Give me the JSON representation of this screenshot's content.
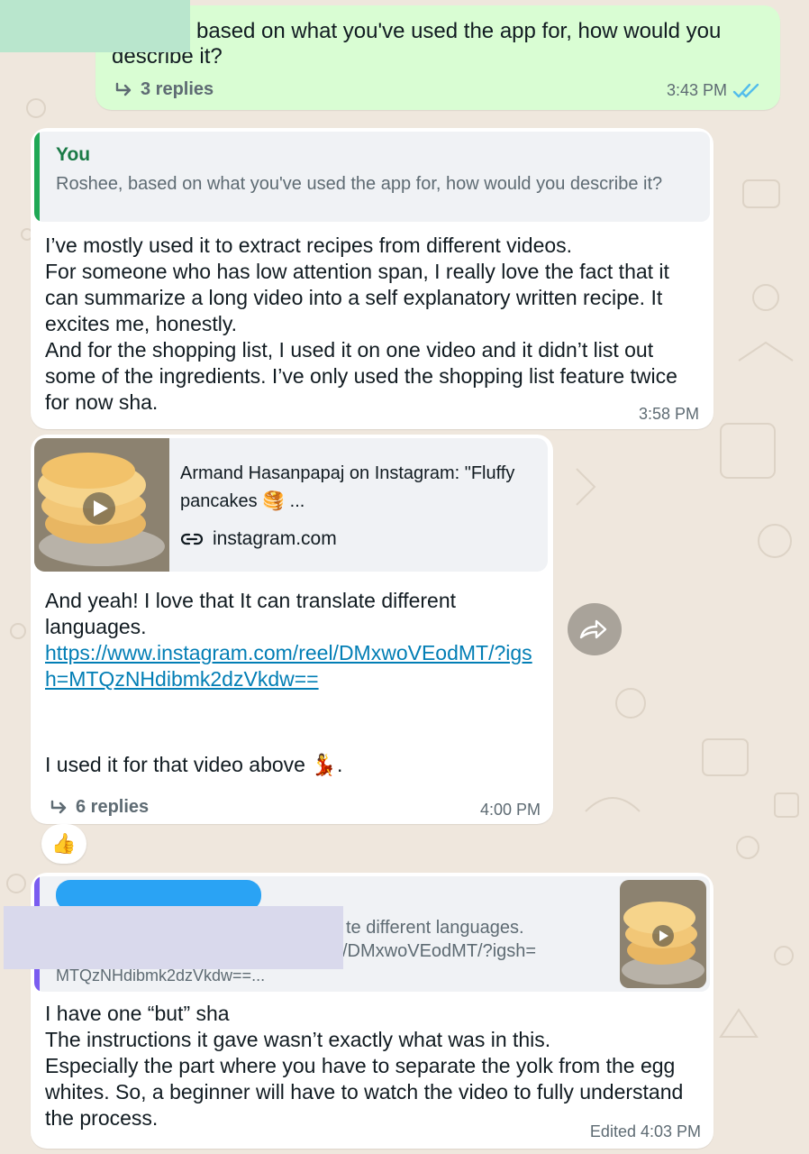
{
  "messages": [
    {
      "id": "m1",
      "text_line1": "based on what you've used the app for, how would you",
      "text_line2": "describe it?",
      "replies": "3 replies",
      "time": "3:43 PM"
    },
    {
      "id": "m2",
      "quote_author": "You",
      "quote_text": "Roshee, based on what you've used the app for, how would you describe it?",
      "text": "I’ve mostly used it to extract recipes from different videos.\nFor someone who has low attention span, I really love the fact that it can summarize a long video into a self explanatory written recipe. It excites me, honestly.\nAnd for the shopping list, I used it on one video and it didn’t list out some of the ingredients. I’ve only used the shopping list feature twice for now sha.",
      "time": "3:58 PM"
    },
    {
      "id": "m3",
      "preview_title": "Armand Hasanpapaj on Instagram: \"Fluffy pancakes 🥞 ...",
      "preview_domain": "instagram.com",
      "text1": "And yeah! I love that It can translate different languages.",
      "link": "https://www.instagram.com/reel/DMxwoVEodMT/?igsh=MTQzNHdibmk2dzVkdw==",
      "text2": "I used it for that video above 💃.",
      "replies": "6 replies",
      "time": "4:00 PM",
      "reaction": "👍"
    },
    {
      "id": "m4",
      "quote_fragment1": "te different languages.",
      "quote_fragment2": "/DMxwoVEodMT/?igsh=",
      "quote_fragment3": "MTQzNHdibmk2dzVkdw==...",
      "text": "I have one “but” sha\nThe instructions it gave wasn’t exactly what was in this.\nEspecially the part where you have to separate the yolk from the egg whites. So, a beginner will have to watch the video to fully understand the process.",
      "time": "Edited 4:03 PM"
    }
  ],
  "colors": {
    "outgoing_bubble": "#d9fdd3",
    "incoming_bubble": "#ffffff",
    "you_accent": "#1fa855",
    "link": "#027eb5",
    "read_ticks": "#53bdeb",
    "redaction_green": "#b9e6cd",
    "redaction_lavender": "#d9d9ec",
    "redaction_blue": "#2aa3f4"
  },
  "icons": [
    "reply-arrow-icon",
    "double-check-icon",
    "link-icon",
    "play-icon",
    "forward-icon"
  ]
}
